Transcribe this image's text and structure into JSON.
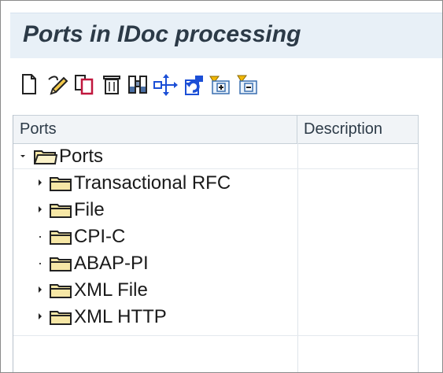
{
  "window": {
    "title": "Ports in IDoc processing"
  },
  "toolbar": {
    "buttons": [
      {
        "name": "create",
        "icon": "new-document-icon"
      },
      {
        "name": "change",
        "icon": "pencil-icon"
      },
      {
        "name": "copy",
        "icon": "copy-icon"
      },
      {
        "name": "delete",
        "icon": "trash-icon"
      },
      {
        "name": "find",
        "icon": "binoculars-icon"
      },
      {
        "name": "where-used",
        "icon": "network-icon"
      },
      {
        "name": "refresh",
        "icon": "refresh-icon"
      },
      {
        "name": "expand-subtree",
        "icon": "expand-icon"
      },
      {
        "name": "collapse-subtree",
        "icon": "collapse-icon"
      }
    ]
  },
  "tree": {
    "columns": [
      "Ports",
      "Description"
    ],
    "root": {
      "label": "Ports",
      "expanded": true
    },
    "children": [
      {
        "label": "Transactional RFC",
        "has_children": true,
        "description": ""
      },
      {
        "label": "File",
        "has_children": true,
        "description": ""
      },
      {
        "label": "CPI-C",
        "has_children": false,
        "description": ""
      },
      {
        "label": "ABAP-PI",
        "has_children": false,
        "description": ""
      },
      {
        "label": "XML File",
        "has_children": true,
        "description": ""
      },
      {
        "label": "XML HTTP",
        "has_children": true,
        "description": ""
      }
    ]
  },
  "colors": {
    "title_bg": "#e8f0f7",
    "header_bg": "#f1f4f7",
    "folder_fill": "#f6e7a6",
    "folder_stroke": "#2a2a2a"
  }
}
